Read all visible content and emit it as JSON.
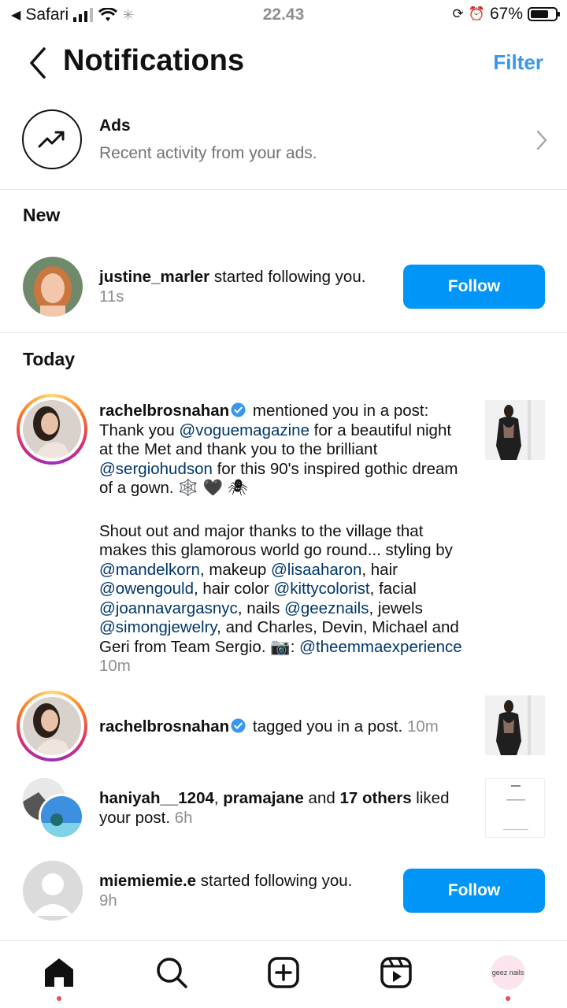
{
  "status": {
    "carrier": "Safari",
    "time": "22.43",
    "battery": "67%",
    "battery_level": 0.67
  },
  "header": {
    "title": "Notifications",
    "filter": "Filter"
  },
  "ads": {
    "title": "Ads",
    "subtitle": "Recent activity from your ads."
  },
  "sections": {
    "new": "New",
    "today": "Today"
  },
  "notifications": [
    {
      "user": "justine_marler",
      "action": " started following you.",
      "time": "11s",
      "button": "Follow"
    },
    {
      "user": "rachelbrosnahan",
      "action": " mentioned you in a post: Thank you ",
      "m1": "@voguemagazine",
      "t1": " for a beautiful night at the Met and thank you to the brilliant ",
      "m2": "@sergiohudson",
      "t2": " for this 90's inspired gothic dream of a gown. 🕸️ 🖤 🕷",
      "p2a": "Shout out and major thanks to the village that makes this glamorous world go round... styling by ",
      "m3": "@mandelkorn",
      "t3": ", makeup ",
      "m4": "@lisaaharon",
      "t4": ", hair ",
      "m5": "@owengould",
      "t5": ", hair color ",
      "m6": "@kittycolorist",
      "t6": ", facial ",
      "m7": "@joannavargasnyc",
      "t7": ", nails ",
      "m8": "@geeznails",
      "t8": ", jewels ",
      "m9": "@simongjewelry",
      "t9": ", and Charles, Devin, Michael and Geri from Team Sergio. 📷: ",
      "m10": "@theemmaexperience",
      "time": "10m"
    },
    {
      "user": "rachelbrosnahan",
      "action": " tagged you in a post.",
      "time": "10m"
    },
    {
      "user1": "haniyah__1204",
      "sep": ", ",
      "user2": "pramajane",
      "and": " and ",
      "others": "17 others",
      "action": " liked your post.",
      "time": "6h"
    },
    {
      "user": "miemiemie.e",
      "action": " started following you.",
      "time": "9h",
      "button": "Follow"
    }
  ],
  "nav": {
    "profile_label": "geez nails"
  },
  "colors": {
    "accent": "#0095f6",
    "mention": "#00376b",
    "secondary_text": "#737373"
  }
}
